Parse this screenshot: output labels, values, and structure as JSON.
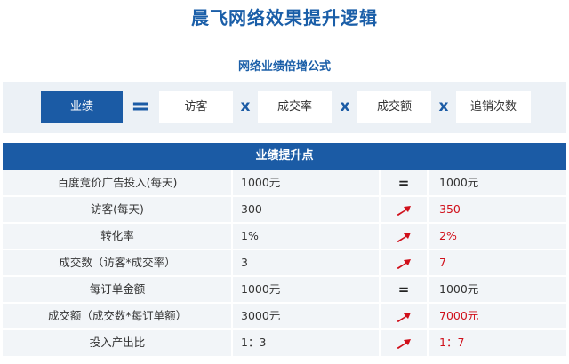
{
  "title": "晨飞网络效果提升逻辑",
  "formula": {
    "title": "网络业绩倍增公式",
    "result": "业绩",
    "equals": "=",
    "times": "x",
    "factors": [
      "访客",
      "成交率",
      "成交额",
      "追销次数"
    ]
  },
  "table": {
    "header": "业绩提升点",
    "rows": [
      {
        "label": "百度竞价广告投入(每天)",
        "before": "1000元",
        "change": "equal",
        "after": "1000元"
      },
      {
        "label": "访客(每天)",
        "before": "300",
        "change": "up",
        "after": "350"
      },
      {
        "label": "转化率",
        "before": "1%",
        "change": "up",
        "after": "2%"
      },
      {
        "label": "成交数（访客*成交率）",
        "before": "3",
        "change": "up",
        "after": "7"
      },
      {
        "label": "每订单金额",
        "before": "1000元",
        "change": "equal",
        "after": "1000元"
      },
      {
        "label": "成交额（成交数*每订单额）",
        "before": "3000元",
        "change": "up",
        "after": "7000元"
      },
      {
        "label": "投入产出比",
        "before": "1：3",
        "change": "up",
        "after": "1：7"
      }
    ],
    "equal_symbol": "=",
    "colors": {
      "accent": "#1b5ba5",
      "increase": "#d0101b",
      "row_bg": "#f2f5f8"
    }
  }
}
